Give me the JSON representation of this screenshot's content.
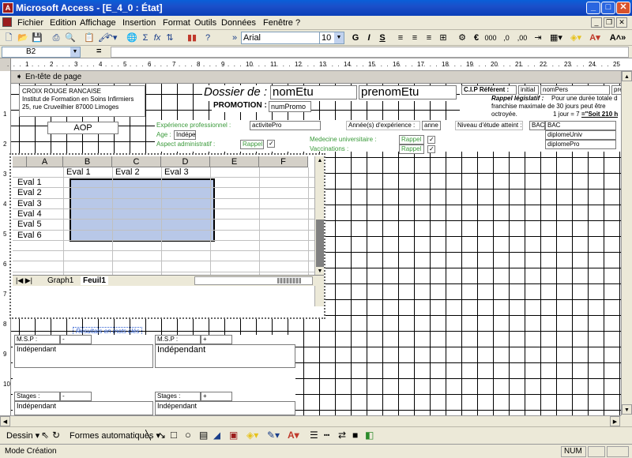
{
  "window": {
    "title": "Microsoft Access - [E_4_0 : État]",
    "app_icon": "access-icon"
  },
  "menu": {
    "items": [
      "Fichier",
      "Edition",
      "Affichage",
      "Insertion",
      "Format",
      "Outils",
      "Données",
      "Fenêtre",
      "?"
    ]
  },
  "toolbar": {
    "font_name": "Arial",
    "font_size": "10",
    "bold": "G",
    "italic": "I",
    "underline": "S",
    "currency": "€",
    "thousands": "000",
    "dec_inc": ",0",
    "dec_dec": ",00",
    "sigma": "Σ",
    "fx": "fx",
    "more": "»"
  },
  "formula_bar": {
    "cell_ref": "B2",
    "equals": "="
  },
  "ruler": {
    "ticks": [
      "1",
      "2",
      "3",
      "4",
      "5",
      "6",
      "7",
      "8",
      "9",
      "10",
      "11",
      "12",
      "13",
      "14",
      "15",
      "16",
      "17",
      "18",
      "19",
      "20",
      "21",
      "22",
      "23",
      "24",
      "25"
    ]
  },
  "vruler": {
    "ticks": [
      "1",
      "2",
      "3",
      "4",
      "5",
      "6",
      "7",
      "8",
      "9",
      "10"
    ]
  },
  "report": {
    "section_header": "En-tête de page",
    "org_line1": "CROIX ROUGE RANCAISE",
    "org_line2": "Institut de Formation en Soins Infirmiers",
    "org_line3": "25, rue Cruveilhier 87000 Limoges",
    "dossier_label": "Dossier de :",
    "nom_etu": "nomEtu",
    "prenom_etu": "prenomEtu",
    "promotion_label": "PROMOTION :",
    "num_promo": "numPromo",
    "cip_label": "C.I.P Référent :",
    "initial": "initial",
    "nom_pers": "nomPers",
    "pre": "pre",
    "rappel_legislatif": "Rappel législatif :",
    "legal_text1": "Pour une durée totale d",
    "legal_text2": "franchise maximale de 30 jours peut être",
    "legal_text3": "octroyée.",
    "jour_text": "1 jour = 7",
    "soit_text": "=\"Soit 210 h",
    "aop": "AOP",
    "exp_pro_label": "Expérience professionnel :",
    "activite_pro": "activitePro",
    "annees_label": "Année(s) d'expérience :",
    "anne": "anne",
    "niveau_label": "Niveau d'étude atteint :",
    "bac_label": "BAC",
    "bac_value": "BAC",
    "diplome_univ": "diplomeUniv",
    "diplome_pro": "diplomePro",
    "age_label": "Age :",
    "age_value": "Indépe",
    "aspect_label": "Aspect administratif :",
    "rappel1": "Rappel",
    "medecine_label": "Medecine universitaire :",
    "rappel2": "Rappel",
    "vaccinations_label": "Vaccinations :",
    "rappel3": "Rappel",
    "resultats_label": "Résultats en mots clés",
    "msp_label": "M.S.P :",
    "dash": "-",
    "plus": "+",
    "independant": "Indépendant",
    "stages_label": "Stages :"
  },
  "excel": {
    "columns": [
      "A",
      "B",
      "C",
      "D",
      "E",
      "F"
    ],
    "headers": [
      "Eval 1",
      "Eval 2",
      "Eval 3"
    ],
    "rows": [
      "Eval 1",
      "Eval 2",
      "Eval 3",
      "Eval 4",
      "Eval 5",
      "Eval 6"
    ],
    "sheet_tabs": [
      "Graph1",
      "Feuil1"
    ]
  },
  "drawbar": {
    "dessin": "Dessin",
    "formes": "Formes automatiques"
  },
  "status": {
    "mode": "Mode Création",
    "num": "NUM"
  },
  "colors": {
    "title_bar": "#0a3fb8",
    "selection": "#b8c8e8",
    "green_label": "#3a9a3a"
  }
}
